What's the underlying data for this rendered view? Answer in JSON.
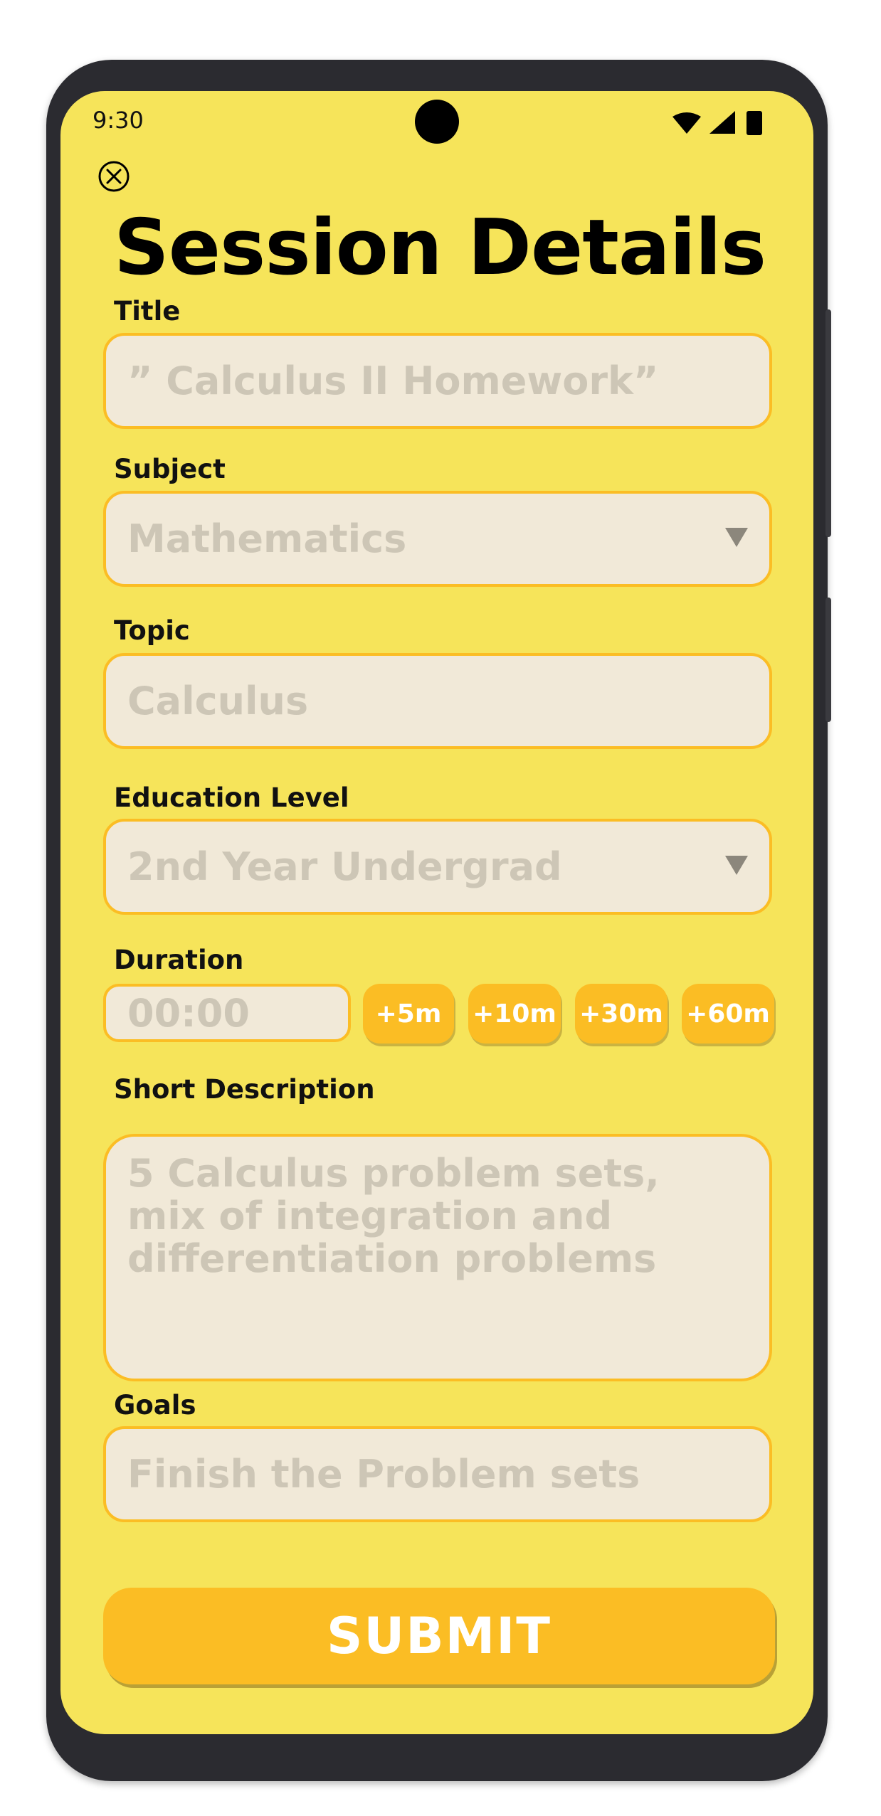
{
  "status_bar": {
    "time": "9:30",
    "icons": [
      "wifi-icon",
      "signal-icon",
      "battery-icon"
    ]
  },
  "header": {
    "title": "Session Details",
    "close_icon": "close-circle-icon"
  },
  "form": {
    "title": {
      "label": "Title",
      "placeholder": "” Calculus II Homework”"
    },
    "subject": {
      "label": "Subject",
      "value": "Mathematics"
    },
    "topic": {
      "label": "Topic",
      "placeholder": "Calculus"
    },
    "education_level": {
      "label": "Education Level",
      "value": "2nd Year Undergrad"
    },
    "duration": {
      "label": "Duration",
      "placeholder": "00:00",
      "presets": [
        "+5m",
        "+10m",
        "+30m",
        "+60m"
      ]
    },
    "description": {
      "label": "Short Description",
      "placeholder_lines": [
        "5 Calculus problem sets,",
        "mix of integration and",
        "differentiation problems"
      ]
    },
    "goals": {
      "label": "Goals",
      "placeholder": "Finish the Problem sets"
    }
  },
  "submit_label": "SUBMIT",
  "colors": {
    "background": "#f6e45a",
    "accent": "#fbbd24",
    "field_fill": "#f1e9d8",
    "placeholder": "#cdc6b6",
    "frame": "#2b2b30"
  }
}
